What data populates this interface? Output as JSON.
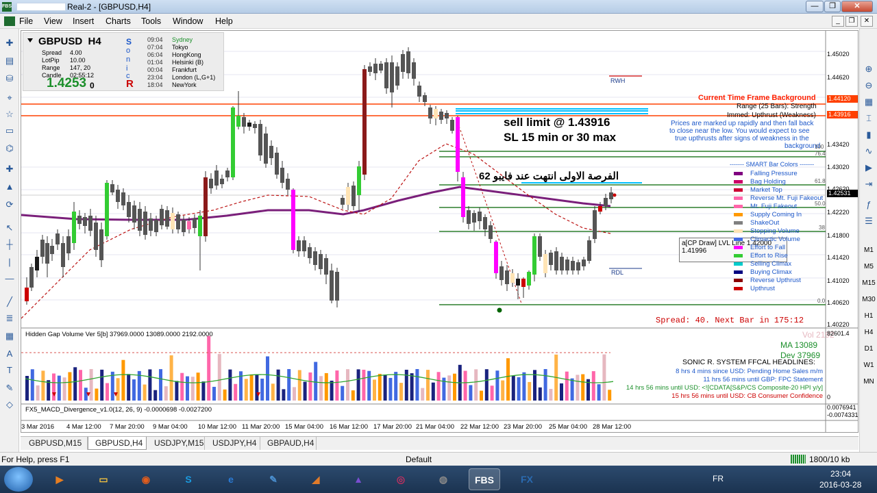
{
  "window": {
    "title": "Real-2 - [GBPUSD,H4]",
    "app_badge": "FBS"
  },
  "window_controls": {
    "minimize": "—",
    "maximize": "❐",
    "close": "✕",
    "mdi_minimize": "_",
    "mdi_restore": "❐",
    "mdi_close": "✕"
  },
  "menu": [
    "File",
    "View",
    "Insert",
    "Charts",
    "Tools",
    "Window",
    "Help"
  ],
  "left_toolbar_icons": [
    "new-chart-icon",
    "profiles-icon",
    "market-watch-icon",
    "navigator-icon",
    "favorites-icon",
    "terminal-icon",
    "tester-icon",
    "new-order-icon",
    "auto-trading-icon",
    "refresh-icon",
    "cursor-icon",
    "crosshair-icon",
    "vertical-line-icon",
    "horizontal-line-icon",
    "trendline-icon",
    "fibo-icon",
    "channels-icon",
    "text-icon",
    "text-label-icon",
    "arrows-icon",
    "shapes-icon"
  ],
  "left_toolbar_glyphs": [
    "✚",
    "▤",
    "⛁",
    "⌖",
    "☆",
    "▭",
    "⌬",
    "✚",
    "▲",
    "⟳",
    "↖",
    "┼",
    "|",
    "—",
    "╱",
    "≣",
    "▦",
    "A",
    "T",
    "✎",
    "◇"
  ],
  "right_toolbar": [
    "",
    "",
    "",
    "",
    "",
    "",
    "",
    "",
    "",
    "",
    "M1",
    "M5",
    "M15",
    "M30",
    "H1",
    "H4",
    "D1",
    "W1",
    "MN"
  ],
  "right_toolbar_icons": [
    "zoom-in-icon",
    "zoom-out-icon",
    "tile-windows-icon",
    "bar-chart-icon",
    "candle-chart-icon",
    "line-chart-icon",
    "autoscroll-icon",
    "chart-shift-icon",
    "indicators-icon",
    "templates-icon"
  ],
  "right_toolbar_glyphs": [
    "⊕",
    "⊖",
    "▦",
    "⌶",
    "▮",
    "∿",
    "▶",
    "⇥",
    "ƒ",
    "☰"
  ],
  "info_panel": {
    "symbol": "GBPUSD",
    "timeframe": "H4",
    "rows": [
      {
        "key": "Spread",
        "value": "4.00"
      },
      {
        "key": "LotPip",
        "value": "10.00"
      },
      {
        "key": "Range",
        "value": "147, 20"
      },
      {
        "key": "Candle",
        "value": "02:55:12"
      }
    ],
    "price": "1.4253",
    "price_suffix": "0",
    "sonic_letters": [
      "S",
      "o",
      "n",
      "i",
      "c",
      "R"
    ],
    "sessions": [
      {
        "time": "09:04",
        "name": "Sydney"
      },
      {
        "time": "07:04",
        "name": "Tokyo"
      },
      {
        "time": "06:04",
        "name": "HongKong"
      },
      {
        "time": "01:04",
        "name": "Helsinki  (B)"
      },
      {
        "time": "00:04",
        "name": "Frankfurt"
      },
      {
        "time": "23:04",
        "name": "London  (L,G+1)"
      },
      {
        "time": "18:04",
        "name": "NewYork"
      }
    ]
  },
  "price_axis": [
    "1.45020",
    "1.44620",
    "1.44120",
    "1.43916",
    "1.43420",
    "1.43020",
    "1.42620",
    "1.42531",
    "1.42220",
    "1.41800",
    "1.41420",
    "1.41020",
    "1.40620",
    "1.40220",
    "82601.4",
    "0",
    "0.0076941",
    "-0.0074331"
  ],
  "highlight_colors": {
    "orange": "#ff4000",
    "current": "#000000",
    "green": "#006400",
    "cyan": "#00bfff"
  },
  "annotations": {
    "current_tf_title": "Current Time Frame Background",
    "range_line": "Range (25 Bars): Strength",
    "immed_line": "Immed: Upthrust (Weakness)",
    "desc_lines": [
      "Prices are marked up rapidly and then fall back",
      "to close near the low. You would expect to see",
      "true upthrusts after signs of weakness in the",
      "background"
    ],
    "sell_limit": "sell limit @ 1.43916",
    "sl_text": "SL 15 min or 30 max",
    "arabic": "الفرصة الاولى انتهت عند فايبو 62",
    "rwh": "RWH",
    "rdl": "RDL",
    "fib_labels": [
      "100",
      "76.4",
      "61.8",
      "50.0",
      "38",
      "0.0"
    ],
    "tooltip_line1": "a[CP Draw] LVL Line 1.42000",
    "tooltip_line2": "1.41996",
    "spread_text": "Spread: 40. Next Bar in 175:12"
  },
  "smart_bar_legend": {
    "title": "------- SMART Bar Colors -------",
    "items": [
      {
        "label": "Falling Pressure",
        "color": "#800080"
      },
      {
        "label": "Bag Holding",
        "color": "#cc0066"
      },
      {
        "label": "Market Top",
        "color": "#cc0033"
      },
      {
        "label": "Reverse Mt. Fuji Fakeout",
        "color": "#ff66aa"
      },
      {
        "label": "Mt. Fuji Fakeout",
        "color": "#ff66aa"
      },
      {
        "label": "Supply Coming In",
        "color": "#ff9900"
      },
      {
        "label": "ShakeOut",
        "color": "#808080"
      },
      {
        "label": "Stopping Volume",
        "color": "#ffe4b5"
      },
      {
        "label": "Climactic Volume",
        "color": "#4169e1"
      },
      {
        "label": "Effort to Fall",
        "color": "#ff00ff"
      },
      {
        "label": "Effort to Rise",
        "color": "#33cc33"
      },
      {
        "label": "Selling Climax",
        "color": "#00cccc"
      },
      {
        "label": "Buying Climax",
        "color": "#000080"
      },
      {
        "label": "Reverse Upthrust",
        "color": "#8b0000"
      },
      {
        "label": "Upthrust",
        "color": "#cc0000"
      }
    ]
  },
  "volume_panel": {
    "title": "Hidden Gap Volume Ver 5[b] 37969.0000 13089.0000 2192.0000",
    "vol": "Vol  2192",
    "ma": "MA  13089",
    "dev": "Dev  37969",
    "system_title": "SONIC R. SYSTEM  FFCAL HEADLINES:",
    "headlines": [
      {
        "text": "8 hrs 4 mins since USD: Pending Home Sales m/m",
        "color": "#1a56c9"
      },
      {
        "text": "11 hrs 56 mins until GBP: FPC Statement",
        "color": "#1a56c9"
      },
      {
        "text": "14 hrs 56 mins until USD: <![CDATA[S&P/CS Composite-20 HPI y/y]",
        "color": "#1b8f2a"
      },
      {
        "text": "15 hrs 56 mins until USD: CB Consumer Confidence",
        "color": "#cc0000"
      }
    ]
  },
  "macd_panel": {
    "title": "FX5_MACD_Divergence_v1.0(12, 26, 9) -0.0000698 -0.0027200"
  },
  "x_axis": [
    "3 Mar 2016",
    "4 Mar 12:00",
    "7 Mar 20:00",
    "9 Mar 04:00",
    "10 Mar 12:00",
    "11 Mar 20:00",
    "15 Mar 04:00",
    "16 Mar 12:00",
    "17 Mar 20:00",
    "21 Mar 04:00",
    "22 Mar 12:00",
    "23 Mar 20:00",
    "25 Mar 04:00",
    "28 Mar 12:00"
  ],
  "tabs": [
    "GBPUSD,M15",
    "GBPUSD,H4",
    "USDJPY,M15",
    "USDJPY,H4",
    "GBPAUD,H4"
  ],
  "active_tab": 1,
  "status": {
    "help": "For Help, press F1",
    "profile": "Default",
    "traffic": "1800/10 kb"
  },
  "taskbar": {
    "apps": [
      "media-player-icon",
      "file-explorer-icon",
      "firefox-icon",
      "skype-icon",
      "internet-explorer-icon",
      "paint-icon",
      "office-icon",
      "matlab-icon",
      "browser-icon",
      "disc-icon",
      "fbs-terminal-icon",
      "fx-terminal-icon"
    ],
    "app_glyphs": [
      "▶",
      "▭",
      "◉",
      "S",
      "e",
      "✎",
      "◢",
      "▲",
      "◎",
      "◍",
      "FBS",
      "FX"
    ],
    "language": "FR",
    "time": "23:04",
    "date": "2016-03-28"
  }
}
